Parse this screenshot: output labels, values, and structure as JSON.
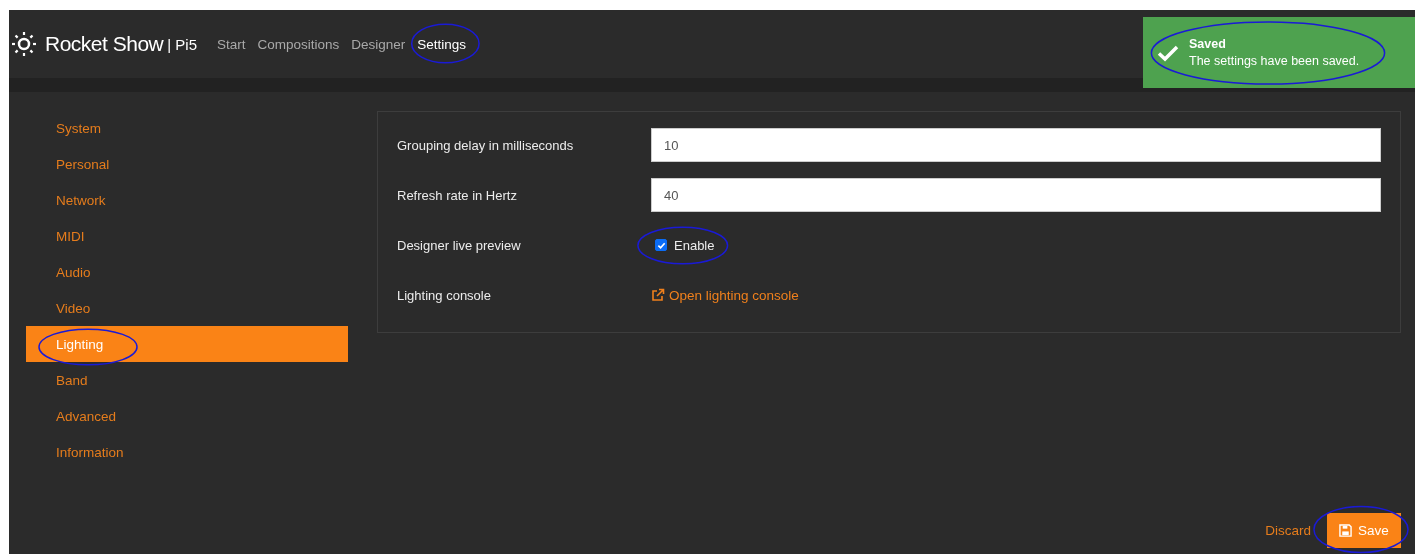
{
  "header": {
    "brand": "Rocket Show",
    "device": "| Pi5",
    "nav": [
      {
        "label": "Start",
        "selected": false,
        "circled": false
      },
      {
        "label": "Compositions",
        "selected": false,
        "circled": false
      },
      {
        "label": "Designer",
        "selected": false,
        "circled": false
      },
      {
        "label": "Settings",
        "selected": true,
        "circled": true
      }
    ]
  },
  "toast": {
    "title": "Saved",
    "message": "The settings have been saved.",
    "circled": true
  },
  "sidebar": {
    "items": [
      {
        "label": "System",
        "selected": false,
        "circled": false
      },
      {
        "label": "Personal",
        "selected": false,
        "circled": false
      },
      {
        "label": "Network",
        "selected": false,
        "circled": false
      },
      {
        "label": "MIDI",
        "selected": false,
        "circled": false
      },
      {
        "label": "Audio",
        "selected": false,
        "circled": false
      },
      {
        "label": "Video",
        "selected": false,
        "circled": false
      },
      {
        "label": "Lighting",
        "selected": true,
        "circled": true
      },
      {
        "label": "Band",
        "selected": false,
        "circled": false
      },
      {
        "label": "Advanced",
        "selected": false,
        "circled": false
      },
      {
        "label": "Information",
        "selected": false,
        "circled": false
      }
    ]
  },
  "settings": [
    {
      "kind": "input",
      "label": "Grouping delay in milliseconds",
      "value": "10"
    },
    {
      "kind": "input",
      "label": "Refresh rate in Hertz",
      "value": "40"
    },
    {
      "kind": "checkbox",
      "label": "Designer live preview",
      "option": "Enable",
      "checked": true,
      "circled": true
    },
    {
      "kind": "link",
      "label": "Lighting console",
      "link": "Open lighting console"
    }
  ],
  "footer": {
    "discard": "Discard",
    "save": "Save",
    "save_circled": true
  }
}
